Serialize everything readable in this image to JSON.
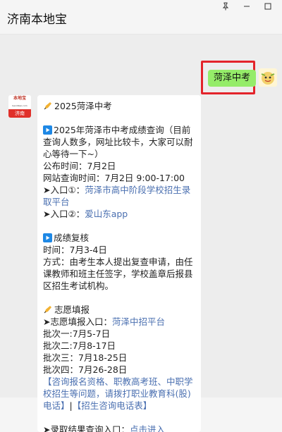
{
  "window": {
    "title": "济南本地宝"
  },
  "outgoing": {
    "text": "菏泽中考"
  },
  "message": {
    "heading": "2025菏泽中考",
    "s1_title": "2025年菏泽市中考成绩查询（目前查询人数多，网址比较卡，大家可以耐心等待一下~）",
    "publish_time": "公布时间：7月2日",
    "site_time": "网站查询时间：7月2日 9:00-17:00",
    "entry1_prefix": "➤入口①：",
    "entry1_link": "菏泽市高中阶段学校招生录取平台",
    "entry2_prefix": "➤入口②：",
    "entry2_link": "爱山东app",
    "s2_title": "成绩复核",
    "s2_time": "时间：7月3-4日",
    "s2_method": "方式：由考生本人提出复查申请，由任课教师和班主任签字，学校盖章后报县区招生考试机构。",
    "s3_title": "志愿填报",
    "s3_entry_prefix": "➤志愿填报入口：",
    "s3_entry_link": "菏泽中招平台",
    "batch1": "批次一:7月5-7日",
    "batch2": "批次二:7月8-17日",
    "batch3": "批次三：7月18-25日",
    "batch4": "批次四：7月26-28日",
    "consult_link1": "【咨询报名资格、职教高考班、中职学校招生等问题，请拨打职业教育科(股)电话】",
    "consult_sep": "|",
    "consult_link2": "【招生咨询电话表】",
    "result_prefix": "➤录取结果查询入口：",
    "result_link": "点击进入"
  },
  "bot_avatar": {
    "top": "本地宝",
    "mid": "bendibao.com",
    "bottom": "济南"
  },
  "icons": {
    "pin": "pin-icon",
    "minimize": "minimize-icon",
    "maximize": "maximize-icon",
    "play": "play-icon",
    "pencil": "pencil-hand-icon"
  },
  "colors": {
    "bubble_out": "#95ec69",
    "highlight": "#e3242b",
    "link": "#4a6fb0",
    "play_icon": "#1e88e5"
  }
}
